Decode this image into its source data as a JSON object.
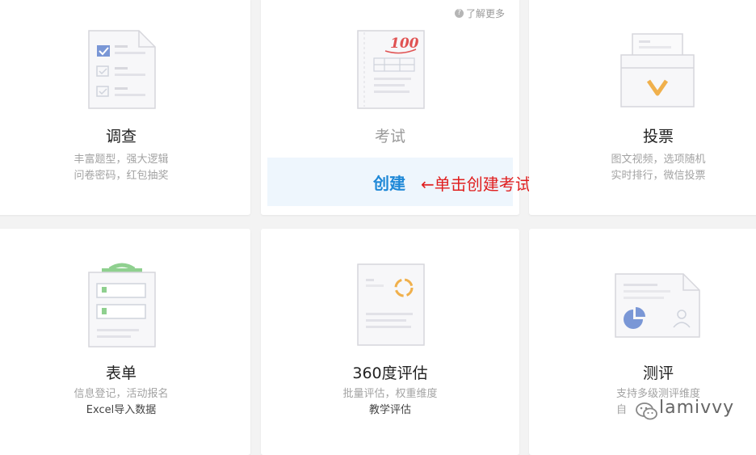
{
  "cards": [
    {
      "title": "调查",
      "lines": [
        "丰富题型，强大逻辑",
        "问卷密码，红包抽奖"
      ]
    },
    {
      "title": "考试",
      "learn_more": "了解更多",
      "create_label": "创建",
      "annotation": "←单击创建考试",
      "score": "100"
    },
    {
      "title": "投票",
      "lines": [
        "图文视频，选项随机",
        "实时排行，微信投票"
      ]
    },
    {
      "title": "表单",
      "lines": [
        "信息登记，活动报名",
        "Excel导入数据"
      ]
    },
    {
      "title": "360度评估",
      "lines": [
        "批量评估，权重维度",
        "教学评估"
      ]
    },
    {
      "title": "测评",
      "lines": [
        "支持多级测评维度",
        "自"
      ]
    }
  ],
  "watermark": "lamivvy",
  "colors": {
    "accent": "#1e88d7",
    "annotation": "#e02020",
    "panel": "#eef6fd"
  }
}
